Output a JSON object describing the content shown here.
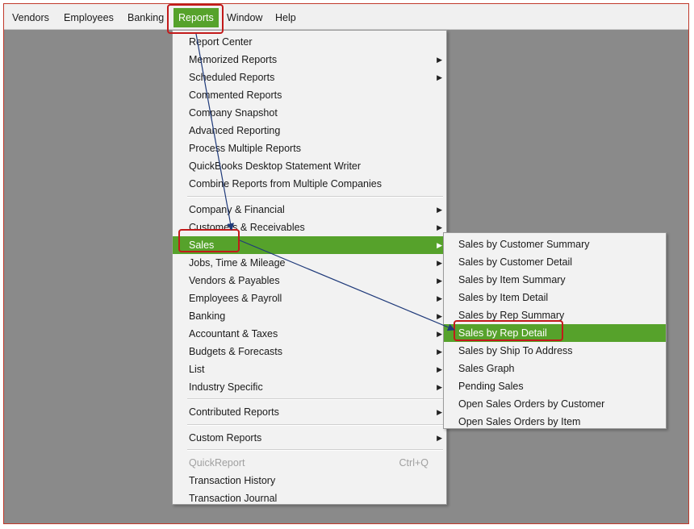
{
  "menubar": {
    "items": [
      {
        "label": "Vendors"
      },
      {
        "label": "Employees"
      },
      {
        "label": "Banking"
      },
      {
        "label": "Reports"
      },
      {
        "label": "Window"
      },
      {
        "label": "Help"
      }
    ]
  },
  "reports_menu": {
    "items": [
      "Report Center",
      "Memorized Reports",
      "Scheduled Reports",
      "Commented Reports",
      "Company Snapshot",
      "Advanced Reporting",
      "Process Multiple Reports",
      "QuickBooks Desktop Statement Writer",
      "Combine Reports from Multiple Companies",
      "Company & Financial",
      "Customers & Receivables",
      "Sales",
      "Jobs, Time & Mileage",
      "Vendors & Payables",
      "Employees & Payroll",
      "Banking",
      "Accountant & Taxes",
      "Budgets & Forecasts",
      "List",
      "Industry Specific",
      "Contributed Reports",
      "Custom Reports",
      "QuickReport",
      "Transaction History",
      "Transaction Journal"
    ],
    "quickreport_shortcut": "Ctrl+Q"
  },
  "sales_submenu": {
    "items": [
      "Sales by Customer Summary",
      "Sales by Customer Detail",
      "Sales by Item Summary",
      "Sales by Item Detail",
      "Sales by Rep Summary",
      "Sales by Rep Detail",
      "Sales by Ship To Address",
      "Sales Graph",
      "Pending Sales",
      "Open Sales Orders by Customer",
      "Open Sales Orders by Item"
    ]
  },
  "colors": {
    "accent_green": "#56a22b",
    "highlight_box": "#c21a1a",
    "arrow": "#1f3a7a"
  }
}
